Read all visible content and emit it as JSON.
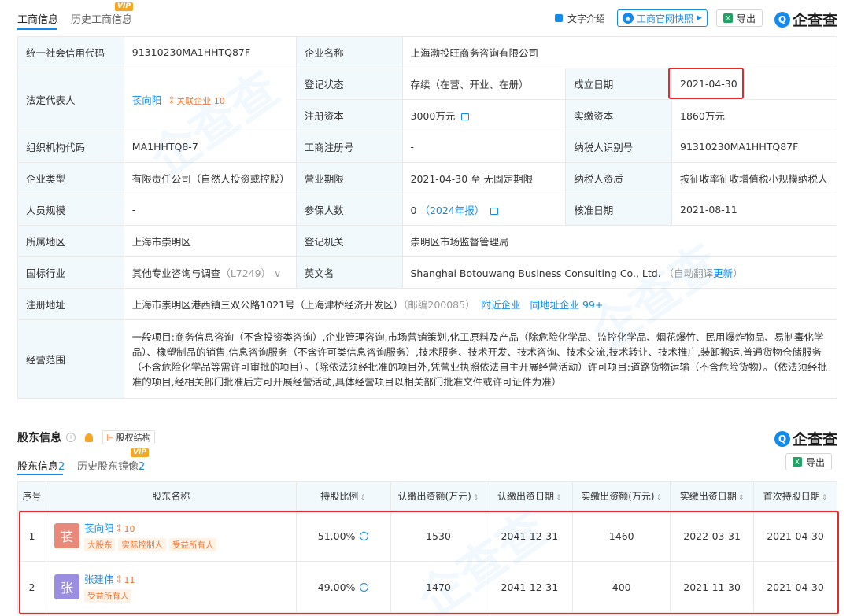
{
  "tabs": {
    "business_info": "工商信息",
    "history_business_info": "历史工商信息",
    "vip": "VIP"
  },
  "toolbar": {
    "text_intro": "文字介绍",
    "official_snapshot": "工商官网快照",
    "export": "导出",
    "logo": "企查查"
  },
  "info": {
    "credit_code_label": "统一社会信用代码",
    "credit_code": "91310230MA1HHTQ87F",
    "company_name_label": "企业名称",
    "company_name": "上海渤投旺商务咨询有限公司",
    "legal_rep_label": "法定代表人",
    "legal_rep_name": "苌向阳",
    "legal_rep_related": "关联企业",
    "legal_rep_related_count": "10",
    "reg_status_label": "登记状态",
    "reg_status": "存续（在营、开业、在册）",
    "found_date_label": "成立日期",
    "found_date": "2021-04-30",
    "reg_capital_label": "注册资本",
    "reg_capital": "3000万元",
    "paid_capital_label": "实缴资本",
    "paid_capital": "1860万元",
    "org_code_label": "组织机构代码",
    "org_code": "MA1HHTQ8-7",
    "biz_reg_no_label": "工商注册号",
    "biz_reg_no": "-",
    "taxpayer_id_label": "纳税人识别号",
    "taxpayer_id": "91310230MA1HHTQ87F",
    "company_type_label": "企业类型",
    "company_type": "有限责任公司（自然人投资或控股）",
    "biz_term_label": "营业期限",
    "biz_term": "2021-04-30 至 无固定期限",
    "taxpayer_qual_label": "纳税人资质",
    "taxpayer_qual": "按征收率征收增值税小规模纳税人",
    "staff_size_label": "人员规模",
    "staff_size": "-",
    "insured_label": "参保人数",
    "insured": "0",
    "insured_year": "（2024年报）",
    "approval_date_label": "核准日期",
    "approval_date": "2021-08-11",
    "region_label": "所属地区",
    "region": "上海市崇明区",
    "reg_authority_label": "登记机关",
    "reg_authority": "崇明区市场监督管理局",
    "industry_label": "国标行业",
    "industry": "其他专业咨询与调查",
    "industry_code": "（L7249）",
    "english_name_label": "英文名",
    "english_name": "Shanghai Botouwang Business Consulting Co., Ltd.",
    "english_name_note": "（自动翻译",
    "english_name_update": "更新",
    "english_name_close": "）",
    "address_label": "注册地址",
    "address": "上海市崇明区港西镇三双公路1021号（上海津桥经济开发区）",
    "postcode": "（邮编200085）",
    "nearby": "附近企业",
    "same_address": "同地址企业 99+",
    "scope_label": "经营范围",
    "scope": "一般项目:商务信息咨询（不含投资类咨询）,企业管理咨询,市场营销策划,化工原料及产品（除危险化学品、监控化学品、烟花爆竹、民用爆炸物品、易制毒化学品）、橡塑制品的销售,信息咨询服务（不含许可类信息咨询服务）,技术服务、技术开发、技术咨询、技术交流,技术转让、技术推广,装卸搬运,普通货物仓储服务（不含危险化学品等需许可审批的项目）。（除依法须经批准的项目外,凭营业执照依法自主开展经营活动）许可项目:道路货物运输（不含危险货物）。（依法须经批准的项目,经相关部门批准后方可开展经营活动,具体经营项目以相关部门批准文件或许可证件为准）"
  },
  "shareholders": {
    "title": "股东信息",
    "equity_structure": "股权结构",
    "logo": "企查查",
    "export": "导出",
    "tab_current": "股东信息",
    "tab_current_count": "2",
    "tab_history": "历史股东镜像",
    "tab_history_count": "2",
    "vip": "VIP",
    "columns": [
      "序号",
      "股东名称",
      "持股比例",
      "认缴出资额(万元)",
      "认缴出资日期",
      "实缴出资额(万元)",
      "实缴出资日期",
      "首次持股日期"
    ],
    "rows": [
      {
        "index": "1",
        "avatar": "苌",
        "avatar_color": "#e8897a",
        "name": "苌向阳",
        "count": "10",
        "tags": [
          "大股东",
          "实际控制人",
          "受益所有人"
        ],
        "ratio": "51.00%",
        "subscribed": "1530",
        "subscribed_date": "2041-12-31",
        "paid": "1460",
        "paid_date": "2022-03-31",
        "first_date": "2021-04-30"
      },
      {
        "index": "2",
        "avatar": "张",
        "avatar_color": "#9b8ee0",
        "name": "张建伟",
        "count": "11",
        "tags": [
          "受益所有人"
        ],
        "ratio": "49.00%",
        "subscribed": "1470",
        "subscribed_date": "2041-12-31",
        "paid": "400",
        "paid_date": "2021-11-30",
        "first_date": "2021-04-30"
      }
    ]
  },
  "colors": {
    "accent": "#128bed",
    "highlight": "#e8262b",
    "tag": "#f5712c"
  }
}
